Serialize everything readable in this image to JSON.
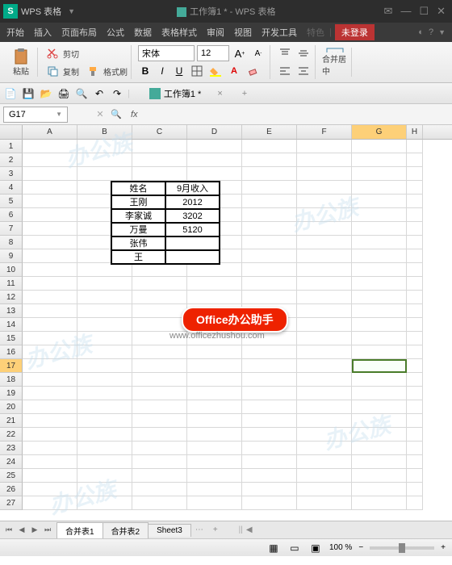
{
  "title": {
    "app_name": "WPS 表格",
    "doc": "工作簿1 * - WPS 表格"
  },
  "menu": {
    "items": [
      "开始",
      "插入",
      "页面布局",
      "公式",
      "数据",
      "表格样式",
      "审阅",
      "视图",
      "开发工具",
      "特色"
    ],
    "login": "未登录"
  },
  "toolbar": {
    "paste": "粘贴",
    "cut": "剪切",
    "copy": "复制",
    "format_painter": "格式刷",
    "font": "宋体",
    "size": "12",
    "merge": "合并居中"
  },
  "doctab": {
    "name": "工作簿1 *"
  },
  "cellref": "G17",
  "cols": [
    "A",
    "B",
    "C",
    "D",
    "E",
    "F",
    "G",
    "H"
  ],
  "rows_count": 27,
  "table": {
    "headers": [
      "姓名",
      "9月收入"
    ],
    "rows": [
      [
        "王刚",
        "2012"
      ],
      [
        "李家诚",
        "3202"
      ],
      [
        "万曼",
        "5120"
      ],
      [
        "张伟",
        ""
      ],
      [
        "王",
        ""
      ]
    ]
  },
  "badge": {
    "text": "Office办公助手",
    "url": "www.officezhushou.com"
  },
  "sheets": [
    "合并表1",
    "合并表2",
    "Sheet3"
  ],
  "status": {
    "zoom": "100 %"
  }
}
